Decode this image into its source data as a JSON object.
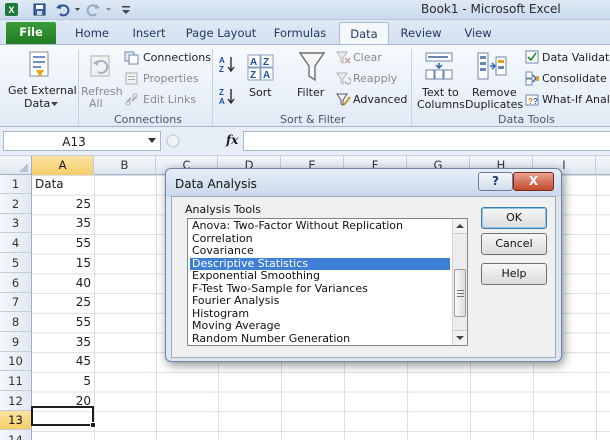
{
  "window": {
    "title": "Book1  -  Microsoft Excel"
  },
  "tabs": [
    {
      "label": "File"
    },
    {
      "label": "Home"
    },
    {
      "label": "Insert"
    },
    {
      "label": "Page Layout"
    },
    {
      "label": "Formulas"
    },
    {
      "label": "Data"
    },
    {
      "label": "Review"
    },
    {
      "label": "View"
    }
  ],
  "active_tab": "Data",
  "ribbon": {
    "get_external": {
      "line1": "Get External",
      "line2": "Data"
    },
    "refresh": {
      "line1": "Refresh",
      "line2": "All"
    },
    "connections": {
      "connections": "Connections",
      "properties": "Properties",
      "edit_links": "Edit Links",
      "group": "Connections"
    },
    "sort_filter": {
      "sort": "Sort",
      "filter": "Filter",
      "clear": "Clear",
      "reapply": "Reapply",
      "advanced": "Advanced",
      "group": "Sort & Filter"
    },
    "data_tools": {
      "text_to_columns_1": "Text to",
      "text_to_columns_2": "Columns",
      "remove_dup_1": "Remove",
      "remove_dup_2": "Duplicates",
      "validation": "Data Validatio",
      "consolidate": "Consolidate",
      "whatif": "What-If Analy",
      "group": "Data Tools"
    }
  },
  "formula_bar": {
    "name_box": "A13",
    "fx": "fx",
    "formula": ""
  },
  "sheet": {
    "columns": [
      "A",
      "B",
      "C",
      "D",
      "E",
      "F",
      "G",
      "H",
      "I"
    ],
    "selected_column": "A",
    "rows": [
      "1",
      "2",
      "3",
      "4",
      "5",
      "6",
      "7",
      "8",
      "9",
      "10",
      "11",
      "12",
      "13",
      "14"
    ],
    "selected_row": "13",
    "column_a": [
      "Data",
      "25",
      "35",
      "55",
      "15",
      "40",
      "25",
      "55",
      "35",
      "45",
      "5",
      "20",
      ""
    ]
  },
  "dialog": {
    "title": "Data Analysis",
    "help_glyph": "?",
    "close_glyph": "X",
    "list_label": "Analysis Tools",
    "items": [
      "Anova: Two-Factor Without Replication",
      "Correlation",
      "Covariance",
      "Descriptive Statistics",
      "Exponential Smoothing",
      "F-Test Two-Sample for Variances",
      "Fourier Analysis",
      "Histogram",
      "Moving Average",
      "Random Number Generation"
    ],
    "selected_item": "Descriptive Statistics",
    "buttons": {
      "ok": "OK",
      "cancel": "Cancel",
      "help": "Help"
    }
  }
}
